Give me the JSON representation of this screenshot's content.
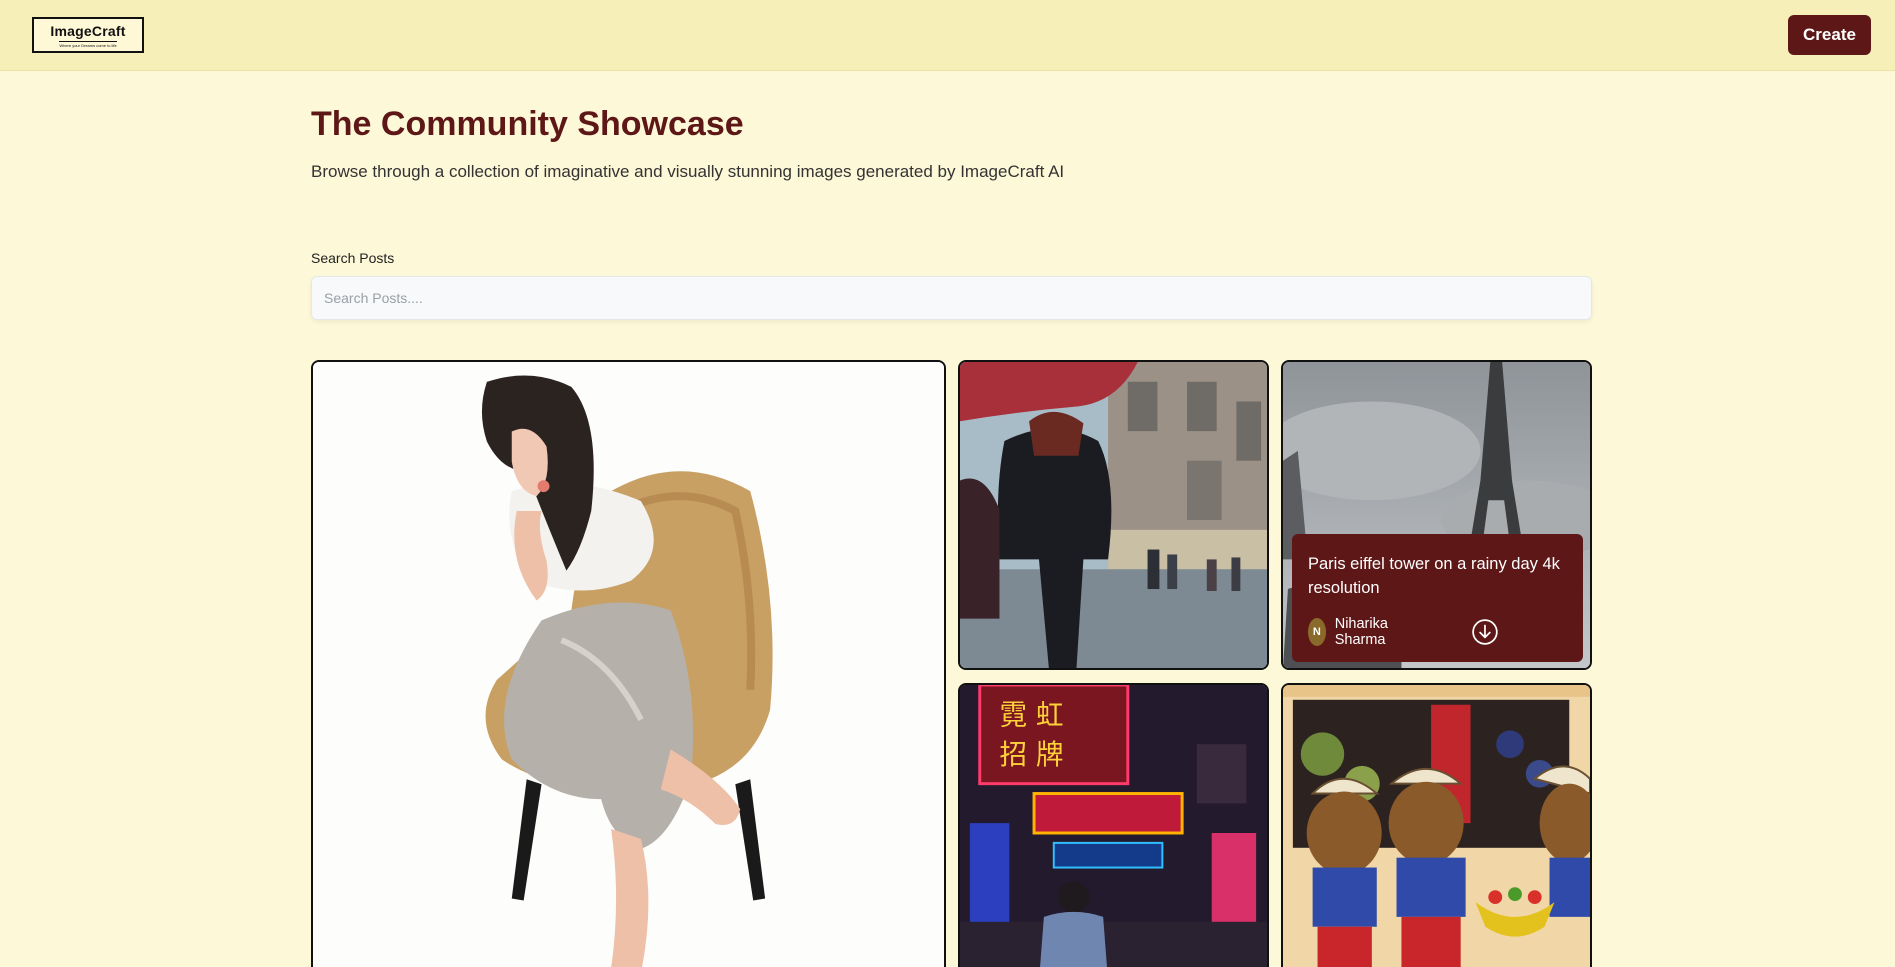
{
  "header": {
    "logo_name": "ImageCraft",
    "logo_tagline": "Where your Dreams come to life",
    "create_label": "Create"
  },
  "main": {
    "title": "The Community Showcase",
    "subtitle": "Browse through a collection of imaginative and visually stunning images generated by ImageCraft AI",
    "search": {
      "label": "Search Posts",
      "placeholder": "Search Posts...."
    }
  },
  "posts": [
    {
      "image": "woman-sitting-on-chair-illustration"
    },
    {
      "image": "person-with-red-umbrella-in-rainy-street"
    },
    {
      "image": "eiffel-tower-rainy-day",
      "prompt": "Paris eiffel tower on a rainy day 4k resolution",
      "author": "Niharika Sharma",
      "author_initial": "N"
    },
    {
      "image": "neon-signs-night-street"
    },
    {
      "image": "cartoon-bears-at-market"
    }
  ],
  "colors": {
    "background": "#fdf8d8",
    "header": "#f7efb8",
    "accent": "#5e1717"
  }
}
